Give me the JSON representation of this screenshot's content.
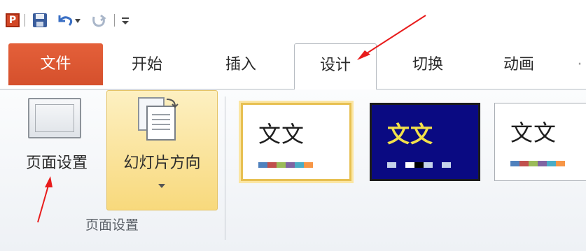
{
  "quick_access": {
    "app_icon_letter": "P",
    "icons": [
      "powerpoint-logo-icon",
      "save-icon",
      "undo-icon",
      "undo-dropdown-icon",
      "redo-icon",
      "customize-toolbar-icon"
    ]
  },
  "tabs": [
    {
      "label": "文件"
    },
    {
      "label": "开始"
    },
    {
      "label": "插入"
    },
    {
      "label": "设计"
    },
    {
      "label": "切换"
    },
    {
      "label": "动画"
    }
  ],
  "ribbon": {
    "page_setup_button": "页面设置",
    "orientation_button": "幻灯片方向",
    "group_label": "页面设置"
  },
  "themes": [
    {
      "sample_text": "文文",
      "swatches": [
        "#4f81bd",
        "#c0504d",
        "#9bbb59",
        "#8064a2",
        "#4bacc6",
        "#f79646"
      ]
    },
    {
      "sample_text": "文文",
      "swatches": [
        "#c5d3ea",
        "#0a0a82",
        "#ffffff",
        "#000000",
        "#c5d3ea",
        "#0a0a82",
        "#c5d3ea"
      ]
    },
    {
      "sample_text": "文文",
      "swatches": [
        "#4f81bd",
        "#c0504d",
        "#9bbb59",
        "#8064a2",
        "#4bacc6",
        "#f79646"
      ]
    }
  ],
  "colors": {
    "file_tab": "#d5502c",
    "selected_button": "#fbe6a3",
    "annotation_arrow": "#e81c1c"
  }
}
